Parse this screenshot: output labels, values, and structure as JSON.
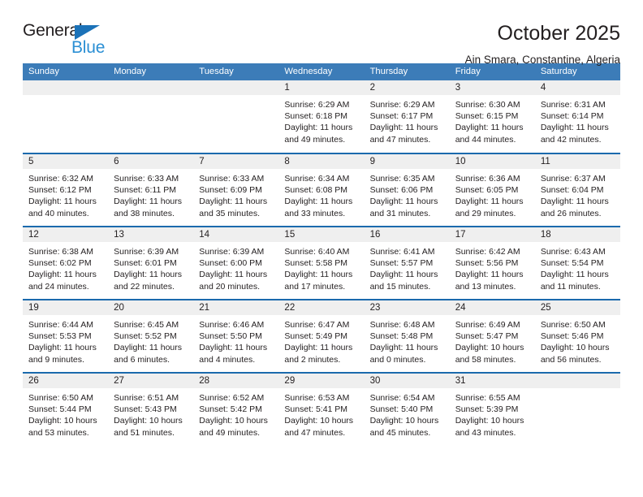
{
  "brand": {
    "name_top": "General",
    "name_bottom": "Blue",
    "triangle_color": "#1b72b8",
    "blue_text_color": "#2b8fd4"
  },
  "header": {
    "title": "October 2025",
    "subtitle": "Ain Smara, Constantine, Algeria"
  },
  "theme": {
    "header_blue": "#3c7cb8",
    "rule_blue": "#1b6aad",
    "daynum_band": "#efefef",
    "text": "#231f20"
  },
  "weekdays": [
    "Sunday",
    "Monday",
    "Tuesday",
    "Wednesday",
    "Thursday",
    "Friday",
    "Saturday"
  ],
  "weeks": [
    [
      {
        "day": "",
        "sunrise": "",
        "sunset": "",
        "daylight_line1": "",
        "daylight_line2": "",
        "empty": true
      },
      {
        "day": "",
        "sunrise": "",
        "sunset": "",
        "daylight_line1": "",
        "daylight_line2": "",
        "empty": true
      },
      {
        "day": "",
        "sunrise": "",
        "sunset": "",
        "daylight_line1": "",
        "daylight_line2": "",
        "empty": true
      },
      {
        "day": "1",
        "sunrise": "Sunrise: 6:29 AM",
        "sunset": "Sunset: 6:18 PM",
        "daylight_line1": "Daylight: 11 hours",
        "daylight_line2": "and 49 minutes."
      },
      {
        "day": "2",
        "sunrise": "Sunrise: 6:29 AM",
        "sunset": "Sunset: 6:17 PM",
        "daylight_line1": "Daylight: 11 hours",
        "daylight_line2": "and 47 minutes."
      },
      {
        "day": "3",
        "sunrise": "Sunrise: 6:30 AM",
        "sunset": "Sunset: 6:15 PM",
        "daylight_line1": "Daylight: 11 hours",
        "daylight_line2": "and 44 minutes."
      },
      {
        "day": "4",
        "sunrise": "Sunrise: 6:31 AM",
        "sunset": "Sunset: 6:14 PM",
        "daylight_line1": "Daylight: 11 hours",
        "daylight_line2": "and 42 minutes."
      }
    ],
    [
      {
        "day": "5",
        "sunrise": "Sunrise: 6:32 AM",
        "sunset": "Sunset: 6:12 PM",
        "daylight_line1": "Daylight: 11 hours",
        "daylight_line2": "and 40 minutes."
      },
      {
        "day": "6",
        "sunrise": "Sunrise: 6:33 AM",
        "sunset": "Sunset: 6:11 PM",
        "daylight_line1": "Daylight: 11 hours",
        "daylight_line2": "and 38 minutes."
      },
      {
        "day": "7",
        "sunrise": "Sunrise: 6:33 AM",
        "sunset": "Sunset: 6:09 PM",
        "daylight_line1": "Daylight: 11 hours",
        "daylight_line2": "and 35 minutes."
      },
      {
        "day": "8",
        "sunrise": "Sunrise: 6:34 AM",
        "sunset": "Sunset: 6:08 PM",
        "daylight_line1": "Daylight: 11 hours",
        "daylight_line2": "and 33 minutes."
      },
      {
        "day": "9",
        "sunrise": "Sunrise: 6:35 AM",
        "sunset": "Sunset: 6:06 PM",
        "daylight_line1": "Daylight: 11 hours",
        "daylight_line2": "and 31 minutes."
      },
      {
        "day": "10",
        "sunrise": "Sunrise: 6:36 AM",
        "sunset": "Sunset: 6:05 PM",
        "daylight_line1": "Daylight: 11 hours",
        "daylight_line2": "and 29 minutes."
      },
      {
        "day": "11",
        "sunrise": "Sunrise: 6:37 AM",
        "sunset": "Sunset: 6:04 PM",
        "daylight_line1": "Daylight: 11 hours",
        "daylight_line2": "and 26 minutes."
      }
    ],
    [
      {
        "day": "12",
        "sunrise": "Sunrise: 6:38 AM",
        "sunset": "Sunset: 6:02 PM",
        "daylight_line1": "Daylight: 11 hours",
        "daylight_line2": "and 24 minutes."
      },
      {
        "day": "13",
        "sunrise": "Sunrise: 6:39 AM",
        "sunset": "Sunset: 6:01 PM",
        "daylight_line1": "Daylight: 11 hours",
        "daylight_line2": "and 22 minutes."
      },
      {
        "day": "14",
        "sunrise": "Sunrise: 6:39 AM",
        "sunset": "Sunset: 6:00 PM",
        "daylight_line1": "Daylight: 11 hours",
        "daylight_line2": "and 20 minutes."
      },
      {
        "day": "15",
        "sunrise": "Sunrise: 6:40 AM",
        "sunset": "Sunset: 5:58 PM",
        "daylight_line1": "Daylight: 11 hours",
        "daylight_line2": "and 17 minutes."
      },
      {
        "day": "16",
        "sunrise": "Sunrise: 6:41 AM",
        "sunset": "Sunset: 5:57 PM",
        "daylight_line1": "Daylight: 11 hours",
        "daylight_line2": "and 15 minutes."
      },
      {
        "day": "17",
        "sunrise": "Sunrise: 6:42 AM",
        "sunset": "Sunset: 5:56 PM",
        "daylight_line1": "Daylight: 11 hours",
        "daylight_line2": "and 13 minutes."
      },
      {
        "day": "18",
        "sunrise": "Sunrise: 6:43 AM",
        "sunset": "Sunset: 5:54 PM",
        "daylight_line1": "Daylight: 11 hours",
        "daylight_line2": "and 11 minutes."
      }
    ],
    [
      {
        "day": "19",
        "sunrise": "Sunrise: 6:44 AM",
        "sunset": "Sunset: 5:53 PM",
        "daylight_line1": "Daylight: 11 hours",
        "daylight_line2": "and 9 minutes."
      },
      {
        "day": "20",
        "sunrise": "Sunrise: 6:45 AM",
        "sunset": "Sunset: 5:52 PM",
        "daylight_line1": "Daylight: 11 hours",
        "daylight_line2": "and 6 minutes."
      },
      {
        "day": "21",
        "sunrise": "Sunrise: 6:46 AM",
        "sunset": "Sunset: 5:50 PM",
        "daylight_line1": "Daylight: 11 hours",
        "daylight_line2": "and 4 minutes."
      },
      {
        "day": "22",
        "sunrise": "Sunrise: 6:47 AM",
        "sunset": "Sunset: 5:49 PM",
        "daylight_line1": "Daylight: 11 hours",
        "daylight_line2": "and 2 minutes."
      },
      {
        "day": "23",
        "sunrise": "Sunrise: 6:48 AM",
        "sunset": "Sunset: 5:48 PM",
        "daylight_line1": "Daylight: 11 hours",
        "daylight_line2": "and 0 minutes."
      },
      {
        "day": "24",
        "sunrise": "Sunrise: 6:49 AM",
        "sunset": "Sunset: 5:47 PM",
        "daylight_line1": "Daylight: 10 hours",
        "daylight_line2": "and 58 minutes."
      },
      {
        "day": "25",
        "sunrise": "Sunrise: 6:50 AM",
        "sunset": "Sunset: 5:46 PM",
        "daylight_line1": "Daylight: 10 hours",
        "daylight_line2": "and 56 minutes."
      }
    ],
    [
      {
        "day": "26",
        "sunrise": "Sunrise: 6:50 AM",
        "sunset": "Sunset: 5:44 PM",
        "daylight_line1": "Daylight: 10 hours",
        "daylight_line2": "and 53 minutes."
      },
      {
        "day": "27",
        "sunrise": "Sunrise: 6:51 AM",
        "sunset": "Sunset: 5:43 PM",
        "daylight_line1": "Daylight: 10 hours",
        "daylight_line2": "and 51 minutes."
      },
      {
        "day": "28",
        "sunrise": "Sunrise: 6:52 AM",
        "sunset": "Sunset: 5:42 PM",
        "daylight_line1": "Daylight: 10 hours",
        "daylight_line2": "and 49 minutes."
      },
      {
        "day": "29",
        "sunrise": "Sunrise: 6:53 AM",
        "sunset": "Sunset: 5:41 PM",
        "daylight_line1": "Daylight: 10 hours",
        "daylight_line2": "and 47 minutes."
      },
      {
        "day": "30",
        "sunrise": "Sunrise: 6:54 AM",
        "sunset": "Sunset: 5:40 PM",
        "daylight_line1": "Daylight: 10 hours",
        "daylight_line2": "and 45 minutes."
      },
      {
        "day": "31",
        "sunrise": "Sunrise: 6:55 AM",
        "sunset": "Sunset: 5:39 PM",
        "daylight_line1": "Daylight: 10 hours",
        "daylight_line2": "and 43 minutes."
      },
      {
        "day": "",
        "sunrise": "",
        "sunset": "",
        "daylight_line1": "",
        "daylight_line2": "",
        "empty": true
      }
    ]
  ]
}
